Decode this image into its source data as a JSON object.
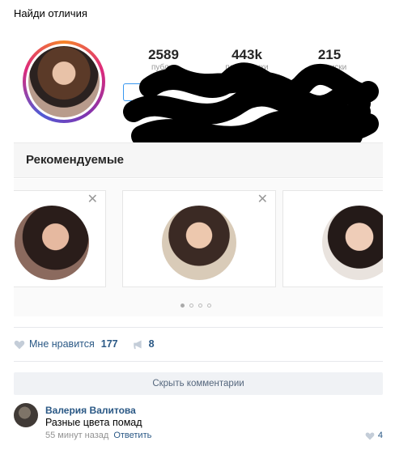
{
  "post": {
    "title": "Найди отличия"
  },
  "instagram": {
    "stats": [
      {
        "number": "2589",
        "label": "публ..."
      },
      {
        "number": "443k",
        "label": "подписчики"
      },
      {
        "number": "215",
        "label": "подписки"
      }
    ],
    "recommended_title": "Рекомендуемые",
    "close_glyph": "✕",
    "carousel_pages": 4,
    "carousel_active": 0
  },
  "actions": {
    "like_label": "Мне нравится",
    "like_count": "177",
    "share_count": "8",
    "icons": [
      "heart-icon",
      "megaphone-icon"
    ]
  },
  "comments": {
    "hide_label": "Скрыть комментарии",
    "items": [
      {
        "author": "Валерия Валитова",
        "text": "Разные цвета помад",
        "time": "55 минут назад",
        "reply_label": "Ответить",
        "likes": "4"
      }
    ]
  },
  "colors": {
    "link": "#2a5885",
    "instagram_blue": "#3897f0"
  }
}
